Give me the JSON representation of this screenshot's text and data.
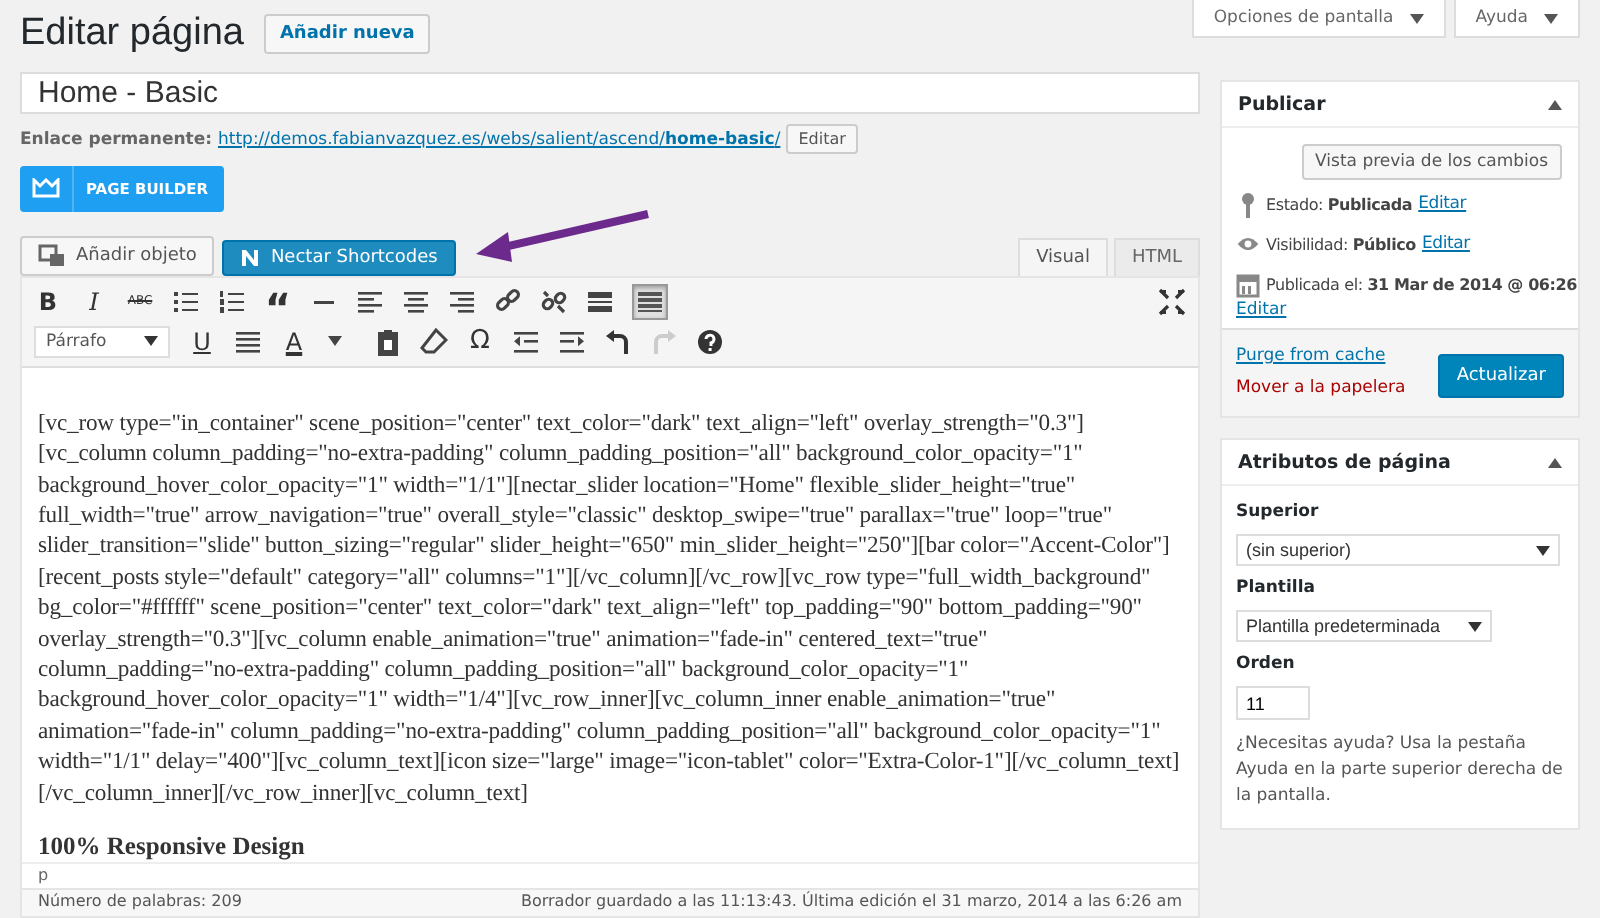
{
  "header": {
    "title": "Editar página",
    "add_new": "Añadir nueva",
    "screen_options": "Opciones de pantalla",
    "help": "Ayuda"
  },
  "post_title": "Home - Basic",
  "permalink": {
    "label": "Enlace permanente:",
    "url_start": "http://demos.fabianvazquez.es/webs/salient/ascend/",
    "slug": "home-basic",
    "url_end": "/",
    "edit": "Editar"
  },
  "page_builder": "PAGE BUILDER",
  "media_buttons": [
    {
      "label": "Añadir objeto",
      "kind": "media"
    },
    {
      "label": "Nectar Shortcodes",
      "kind": "nectar"
    }
  ],
  "tabs": [
    {
      "label": "Visual",
      "selected": true
    },
    {
      "label": "HTML",
      "selected": false
    }
  ],
  "toolbar": {
    "bold": "B",
    "italic": "I",
    "strike": "ABC",
    "quote": "“",
    "omega": "Ω",
    "underline": "U",
    "text_color": "A",
    "format": "Párrafo",
    "toolbar_toggle_pressed": true,
    "redo_disabled": true
  },
  "content_lines": [
    "[vc_row type=\"in_container\" scene_position=\"center\" text_color=\"dark\" text_align=\"left\" overlay_strength=\"0.3\"]",
    "[vc_column column_padding=\"no-extra-padding\" column_padding_position=\"all\" background_color_opacity=\"1\"",
    "background_hover_color_opacity=\"1\" width=\"1/1\"][nectar_slider location=\"Home\" flexible_slider_height=\"true\"",
    "full_width=\"true\" arrow_navigation=\"true\" overall_style=\"classic\" desktop_swipe=\"true\" parallax=\"true\" loop=\"true\"",
    "slider_transition=\"slide\" button_sizing=\"regular\" slider_height=\"650\" min_slider_height=\"250\"][bar color=\"Accent-Color\"]",
    "[recent_posts style=\"default\" category=\"all\" columns=\"1\"][/vc_column][/vc_row][vc_row type=\"full_width_background\"",
    "bg_color=\"#ffffff\" scene_position=\"center\" text_color=\"dark\" text_align=\"left\" top_padding=\"90\" bottom_padding=\"90\"",
    "overlay_strength=\"0.3\"][vc_column enable_animation=\"true\" animation=\"fade-in\" centered_text=\"true\"",
    "column_padding=\"no-extra-padding\" column_padding_position=\"all\" background_color_opacity=\"1\"",
    "background_hover_color_opacity=\"1\" width=\"1/4\"][vc_row_inner][vc_column_inner enable_animation=\"true\"",
    "animation=\"fade-in\" column_padding=\"no-extra-padding\" column_padding_position=\"all\" background_color_opacity=\"1\"",
    "width=\"1/1\" delay=\"400\"][vc_column_text][icon size=\"large\" image=\"icon-tablet\" color=\"Extra-Color-1\"][/vc_column_text]",
    "[/vc_column_inner][/vc_row_inner][vc_column_text]"
  ],
  "content_heading": "100% Responsive Design",
  "path": "p",
  "word_count": "Número de palabras: 209",
  "autosave": "Borrador guardado a las 11:13:43. Última edición el 31 marzo, 2014 a las 6:26 am",
  "publish": {
    "title": "Publicar",
    "preview": "Vista previa de los cambios",
    "status_label": "Estado:",
    "status": "Publicada",
    "visibility_label": "Visibilidad:",
    "visibility": "Público",
    "date_label": "Publicada el:",
    "date": "31 Mar de 2014 @ 06:26",
    "edit_status": "Editar",
    "edit_visibility": "Editar",
    "edit_date": "Editar",
    "purge": "Purge from cache",
    "trash": "Mover a la papelera",
    "update": "Actualizar"
  },
  "attributes": {
    "title": "Atributos de página",
    "parent_label": "Superior",
    "parent": "(sin superior)",
    "template_label": "Plantilla",
    "template": "Plantilla predeterminada",
    "order_label": "Orden",
    "order": "11",
    "help": "¿Necesitas ayuda? Usa la pestaña Ayuda en la parte superior derecha de la pantalla."
  }
}
